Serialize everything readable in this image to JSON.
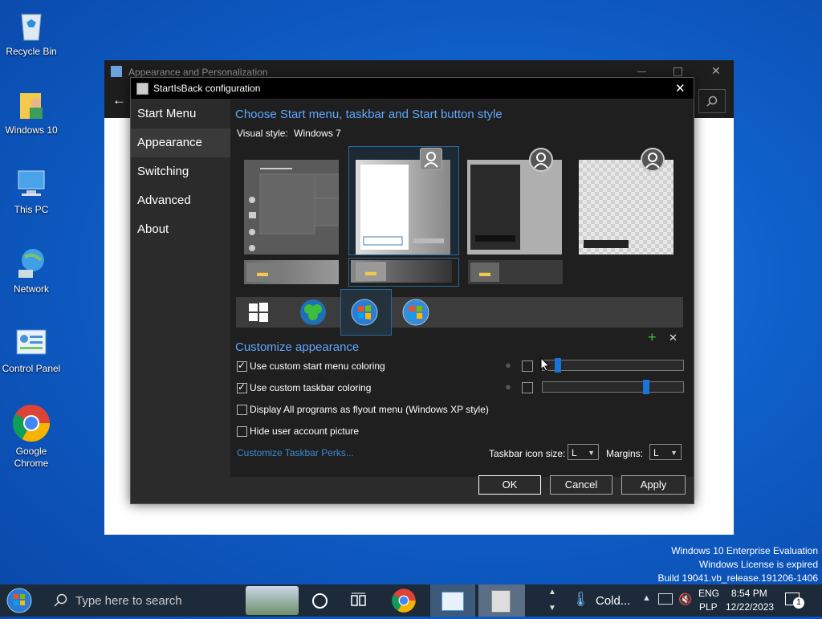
{
  "desktop": {
    "icons": [
      {
        "label": "Recycle Bin"
      },
      {
        "label": "Windows 10"
      },
      {
        "label": "This PC"
      },
      {
        "label": "Network"
      },
      {
        "label": "Control Panel"
      },
      {
        "label": "Google Chrome"
      }
    ]
  },
  "background_window": {
    "title": "Appearance and Personalization"
  },
  "dialog": {
    "title": "StartIsBack configuration",
    "nav": [
      "Start Menu",
      "Appearance",
      "Switching",
      "Advanced",
      "About"
    ],
    "active_nav": "Appearance",
    "style_heading": "Choose Start menu, taskbar and Start button style",
    "visual_style_label": "Visual style:",
    "visual_style_value": "Windows 7",
    "customize_heading": "Customize appearance",
    "options": [
      {
        "label": "Use custom start menu coloring",
        "checked": true
      },
      {
        "label": "Use custom taskbar coloring",
        "checked": true
      },
      {
        "label": "Display All programs as flyout menu (Windows XP style)",
        "checked": false
      },
      {
        "label": "Hide user account picture",
        "checked": false
      }
    ],
    "slider1_value": 0.04,
    "slider2_value": 0.75,
    "perks_link": "Customize Taskbar Perks...",
    "icon_size_label": "Taskbar icon size:",
    "icon_size_value": "L",
    "margins_label": "Margins:",
    "margins_value": "L",
    "ok": "OK",
    "cancel": "Cancel",
    "apply": "Apply",
    "close_glyph": "✕",
    "add_glyph": "+"
  },
  "watermark": {
    "line1": "Windows 10 Enterprise Evaluation",
    "line2": "Windows License is expired",
    "line3": "Build 19041.vb_release.191206-1406"
  },
  "taskbar": {
    "search_placeholder": "Type here to search",
    "weather": "Cold...",
    "lang1": "ENG",
    "lang2": "PLP",
    "time": "8:54 PM",
    "date": "12/22/2023",
    "notification_count": "1"
  },
  "colors": {
    "accent": "#1a73d8",
    "heading_blue": "#5fa8ff"
  }
}
